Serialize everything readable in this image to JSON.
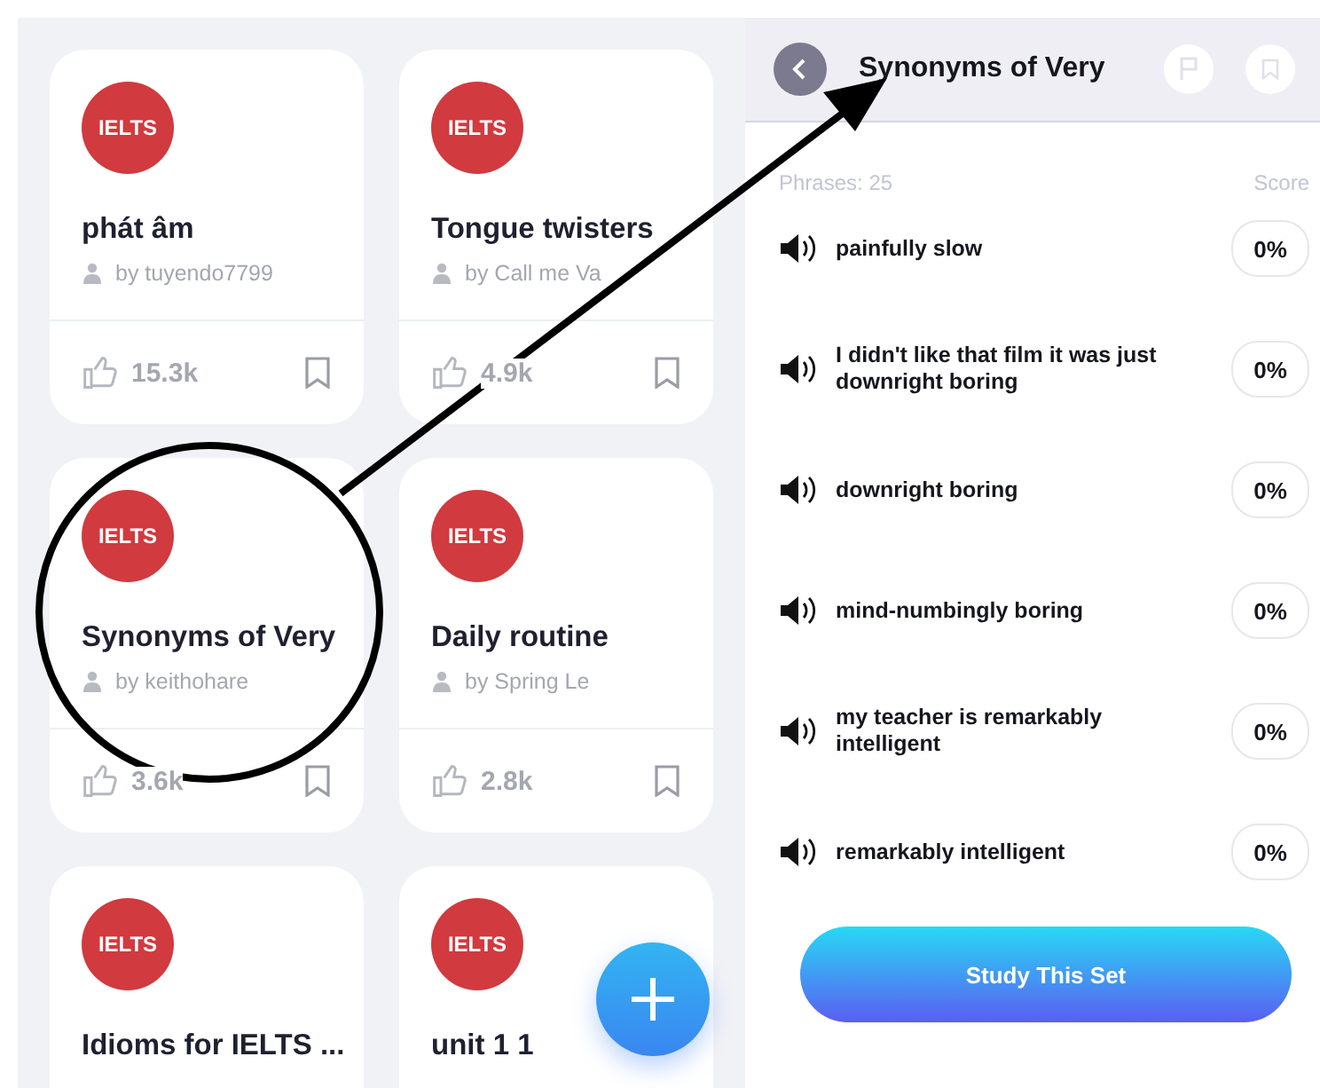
{
  "sets": [
    {
      "badge": "IELTS",
      "title": "phát âm",
      "author": "by tuyendo7799",
      "likes": "15.3k"
    },
    {
      "badge": "IELTS",
      "title": "Tongue twisters",
      "author": "by Call me Va",
      "likes": "4.9k"
    },
    {
      "badge": "IELTS",
      "title": "Synonyms of Very",
      "author": "by keithohare",
      "likes": "3.6k"
    },
    {
      "badge": "IELTS",
      "title": "Daily routine",
      "author": "by Spring Le",
      "likes": "2.8k"
    },
    {
      "badge": "IELTS",
      "title": "Idioms for IELTS ..."
    },
    {
      "badge": "IELTS",
      "title": "unit 1 1"
    }
  ],
  "detail": {
    "title": "Synonyms of Very",
    "count_label": "Phrases: 25",
    "score_label": "Score",
    "phrases": [
      {
        "text": "painfully slow",
        "score": "0%"
      },
      {
        "text": "I didn't like that film it was just downright boring",
        "score": "0%"
      },
      {
        "text": "downright boring",
        "score": "0%"
      },
      {
        "text": "mind-numbingly boring",
        "score": "0%"
      },
      {
        "text": "my teacher is remarkably intelligent",
        "score": "0%"
      },
      {
        "text": "remarkably intelligent",
        "score": "0%"
      }
    ],
    "action": "Study This Set"
  }
}
